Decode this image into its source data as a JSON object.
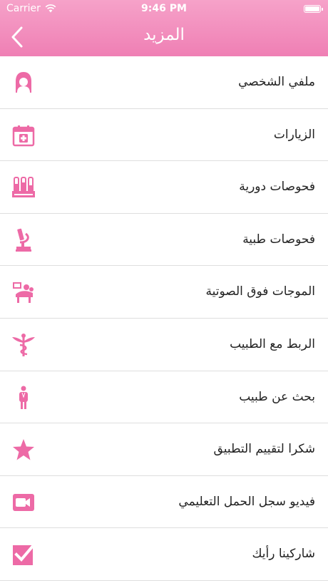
{
  "status_bar": {
    "carrier": "Carrier",
    "time": "9:46 PM"
  },
  "nav": {
    "title": "المزيد"
  },
  "menu": [
    {
      "label": "ملفي الشخصي",
      "icon": "profile-icon"
    },
    {
      "label": "الزيارات",
      "icon": "calendar-icon"
    },
    {
      "label": "فحوصات دورية",
      "icon": "test-tubes-icon"
    },
    {
      "label": "فحوصات طبية",
      "icon": "microscope-icon"
    },
    {
      "label": "الموجات فوق الصوتية",
      "icon": "ultrasound-icon"
    },
    {
      "label": "الربط مع الطبيب",
      "icon": "caduceus-icon"
    },
    {
      "label": "بحث عن طبيب",
      "icon": "doctor-icon"
    },
    {
      "label": "شكرا لتقييم التطبيق",
      "icon": "star-icon"
    },
    {
      "label": "فيديو سجل الحمل التعليمي",
      "icon": "video-icon"
    },
    {
      "label": "شاركينا رأيك",
      "icon": "checkbox-icon"
    }
  ],
  "colors": {
    "accent": "#ed6aa6",
    "header_top": "#f6a2c9",
    "header_bottom": "#ef7fb4"
  }
}
